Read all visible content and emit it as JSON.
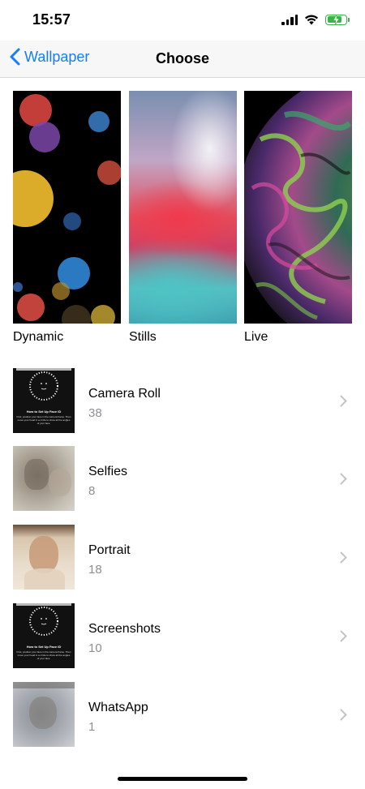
{
  "status_bar": {
    "time": "15:57",
    "icons": [
      "cellular-signal-icon",
      "wifi-icon",
      "battery-charging-icon"
    ],
    "battery_color": "#3bb34a"
  },
  "nav": {
    "back_label": "Wallpaper",
    "title": "Choose",
    "accent_color": "#157efb"
  },
  "categories": [
    {
      "label": "Dynamic"
    },
    {
      "label": "Stills"
    },
    {
      "label": "Live"
    }
  ],
  "albums": [
    {
      "name": "Camera Roll",
      "count": "38",
      "thumb": "face-id-setup"
    },
    {
      "name": "Selfies",
      "count": "8",
      "thumb": "blurred-photo"
    },
    {
      "name": "Portrait",
      "count": "18",
      "thumb": "blurred-portrait"
    },
    {
      "name": "Screenshots",
      "count": "10",
      "thumb": "face-id-setup"
    },
    {
      "name": "WhatsApp",
      "count": "1",
      "thumb": "blurred-photo"
    }
  ],
  "face_thumb": {
    "title": "How to Set Up Face ID",
    "body": "First, position your face in the camera frame. Then move your head in a circle to show all the angles of your face."
  }
}
